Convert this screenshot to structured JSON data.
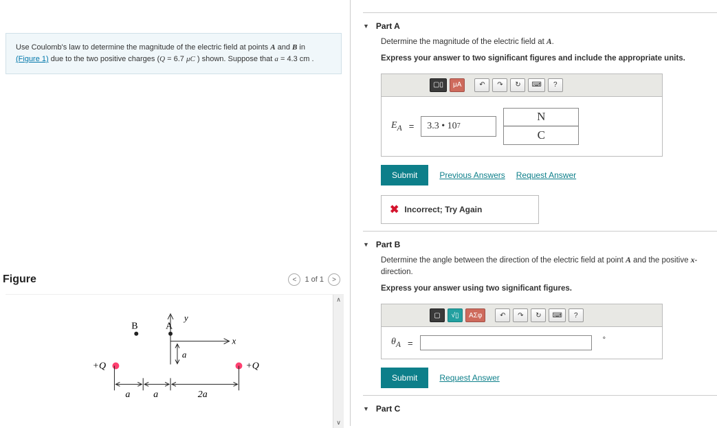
{
  "problem": {
    "text_prefix": "Use Coulomb's law to determine the magnitude of the electric field at points ",
    "pointA": "A",
    "and": " and ",
    "pointB": "B",
    "in": " in ",
    "figure_link": "(Figure 1)",
    "text_mid": " due to the two positive charges (",
    "Q": "Q",
    "eq1": " = 6.7 ",
    "mu": "μC",
    "text_end1": " ) shown. Suppose that ",
    "a": "a",
    "eq2": " = 4.3 ",
    "cm": "cm",
    "period": " ."
  },
  "figure": {
    "title": "Figure",
    "nav_prev": "<",
    "nav_label": "1 of 1",
    "nav_next": ">",
    "labels": {
      "B": "B",
      "A": "A",
      "y": "y",
      "x": "x",
      "plusQ_left": "+Q",
      "plusQ_right": "+Q",
      "a_low1": "a",
      "a_low2": "a",
      "a_mid": "a",
      "twoa": "2a"
    }
  },
  "partA": {
    "label": "Part A",
    "instr1": "Determine the magnitude of the electric field at ",
    "instr1_pt": "A",
    "instr1_end": ".",
    "instr2": "Express your answer to two significant figures and include the appropriate units.",
    "toolbar": {
      "templates": "▢▯",
      "units": "μA",
      "undo": "↶",
      "redo": "↷",
      "reset": "↻",
      "keyboard": "⌨",
      "help": "?"
    },
    "variable": "E",
    "subscript": "A",
    "equals": "=",
    "value": "3.3 • 10",
    "value_exp": "7",
    "unit_num": "N",
    "unit_den": "C",
    "submit": "Submit",
    "previous": "Previous Answers",
    "request": "Request Answer",
    "feedback": "Incorrect; Try Again"
  },
  "partB": {
    "label": "Part B",
    "instr1_a": "Determine the angle between the direction of the electric field at point ",
    "instr1_pt": "A",
    "instr1_b": " and the positive ",
    "instr1_x": "x",
    "instr1_c": "-direction.",
    "instr2": "Express your answer using two significant figures.",
    "toolbar": {
      "templates": "▢",
      "root": "√▯",
      "greek": "ΑΣφ",
      "undo": "↶",
      "redo": "↷",
      "reset": "↻",
      "keyboard": "⌨",
      "help": "?"
    },
    "variable": "θ",
    "subscript": "A",
    "equals": "=",
    "value": "",
    "degree": "°",
    "submit": "Submit",
    "request": "Request Answer"
  },
  "partC": {
    "label": "Part C"
  }
}
